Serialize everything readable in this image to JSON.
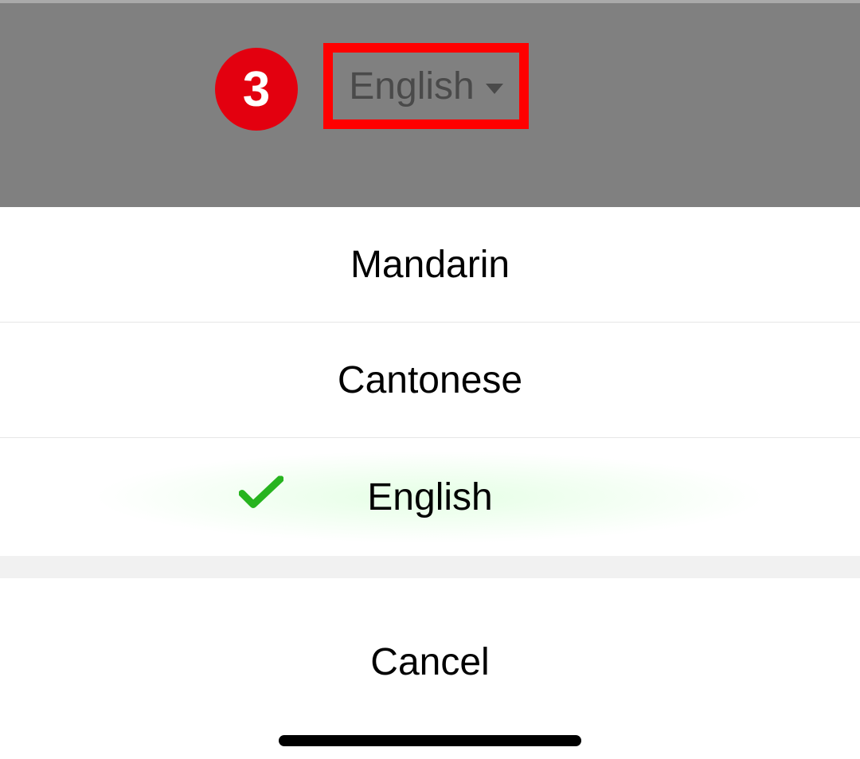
{
  "annotation": {
    "step_number": "3"
  },
  "header": {
    "selected_language": "English"
  },
  "sheet": {
    "options": {
      "mandarin": "Mandarin",
      "cantonese": "Cantonese",
      "english": "English"
    },
    "selected": "english",
    "cancel": "Cancel"
  }
}
